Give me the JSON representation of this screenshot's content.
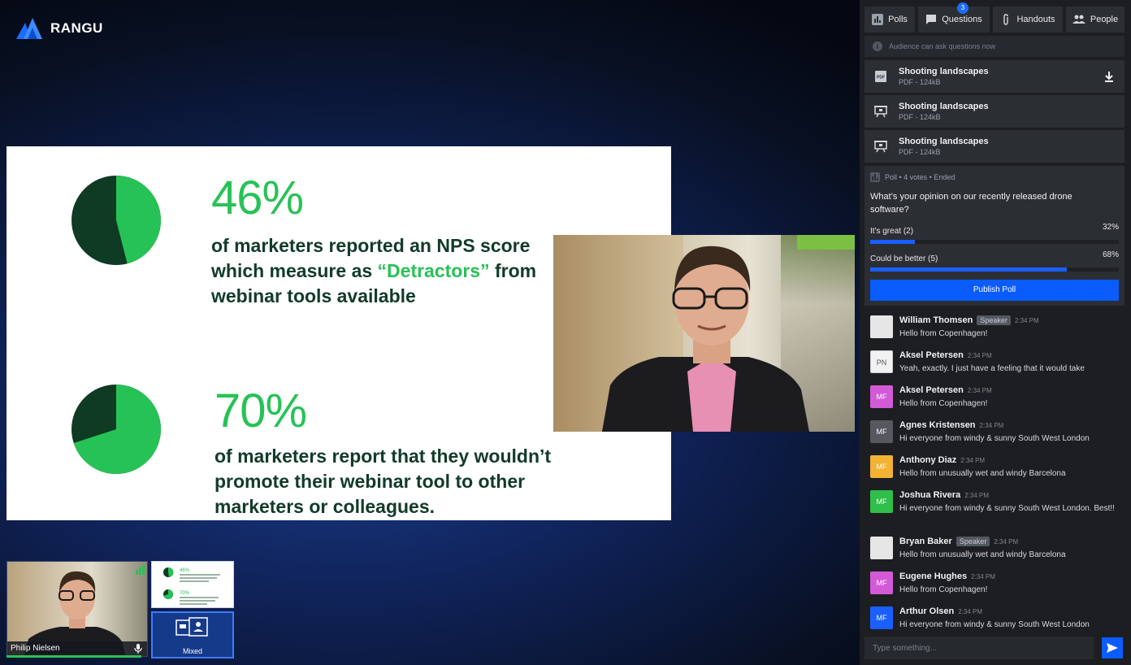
{
  "brand": {
    "name": "RANGU"
  },
  "slide": {
    "stats": [
      {
        "value": "46%",
        "line1": "of marketers reported an NPS score",
        "line2_pre": "which measure as ",
        "line2_hl": "“Detractors”",
        "line2_post": " from",
        "line3": "webinar tools available",
        "share": 0.46
      },
      {
        "value": "70%",
        "line1": "of marketers report that they wouldn’t",
        "line2_pre": "promote their webinar tool to other",
        "line2_hl": "",
        "line2_post": "",
        "line3": "marketers or colleagues.",
        "share": 0.7
      }
    ]
  },
  "thumbnails": {
    "camera_name": "Philip Nielsen",
    "mixed_label": "Mixed"
  },
  "colors": {
    "accent": "#0a5cff",
    "slide_green": "#27c256",
    "slide_dark": "#0f3a24"
  },
  "tabs": [
    {
      "label": "Polls",
      "icon": "poll-icon"
    },
    {
      "label": "Questions",
      "icon": "chat-icon",
      "badge": "3"
    },
    {
      "label": "Handouts",
      "icon": "paperclip-icon"
    },
    {
      "label": "People",
      "icon": "people-icon"
    }
  ],
  "info": {
    "text": "Audience can ask questions now"
  },
  "handouts": [
    {
      "title": "Shooting landscapes",
      "meta": "PDF - 124kB",
      "icon": "pdf-icon",
      "download": true
    },
    {
      "title": "Shooting landscapes",
      "meta": "PDF - 124kB",
      "icon": "presentation-icon",
      "download": false
    },
    {
      "title": "Shooting landscapes",
      "meta": "PDF - 124kB",
      "icon": "presentation-icon",
      "download": false
    }
  ],
  "poll": {
    "meta": "Poll • 4 votes • Ended",
    "question": "What’s your opinion on our recently released drone software?",
    "options": [
      {
        "label": "It's great (2)",
        "pct": "32%",
        "fill": 0.18
      },
      {
        "label": "Could be better  (5)",
        "pct": "68%",
        "fill": 0.79
      }
    ],
    "publish_label": "Publish Poll"
  },
  "messages": [
    {
      "name": "William Thomsen",
      "role": "Speaker",
      "time": "2:34 PM",
      "text": "Hello from Copenhagen!",
      "initials": "",
      "color": "#e6e6e6"
    },
    {
      "name": "Aksel Petersen",
      "role": "",
      "time": "2:34 PM",
      "text": "Yeah, exactly. I just have a feeling that it would take",
      "initials": "PN",
      "color": "#f2f2f2"
    },
    {
      "name": "Aksel Petersen",
      "role": "",
      "time": "2:34 PM",
      "text": "Hello from Copenhagen!",
      "initials": "MF",
      "color": "#d35ad6"
    },
    {
      "name": "Agnes Kristensen",
      "role": "",
      "time": "2:34 PM",
      "text": "Hi everyone from windy & sunny South West London",
      "initials": "MF",
      "color": "#55595f"
    },
    {
      "name": "Anthony Diaz",
      "role": "",
      "time": "2:34 PM",
      "text": "Hello from unusually wet and windy Barcelona",
      "initials": "MF",
      "color": "#f2b233"
    },
    {
      "name": "Joshua Rivera",
      "role": "",
      "time": "2:34 PM",
      "text": "Hi everyone from windy & sunny South West London. Best!!",
      "initials": "MF",
      "color": "#2fbf4a"
    },
    {
      "name": "Bryan Baker",
      "role": "Speaker",
      "time": "2:34 PM",
      "text": "Hello from unusually wet and windy Barcelona",
      "initials": "",
      "color": "#e6e6e6"
    },
    {
      "name": "Eugene Hughes",
      "role": "",
      "time": "2:34 PM",
      "text": "Hello from Copenhagen!",
      "initials": "MF",
      "color": "#d35ad6"
    },
    {
      "name": "Arthur Olsen",
      "role": "",
      "time": "2:34 PM",
      "text": "Hi everyone from windy & sunny South West London",
      "initials": "MF",
      "color": "#1a5fff"
    }
  ],
  "chat_input": {
    "placeholder": "Type something..."
  }
}
